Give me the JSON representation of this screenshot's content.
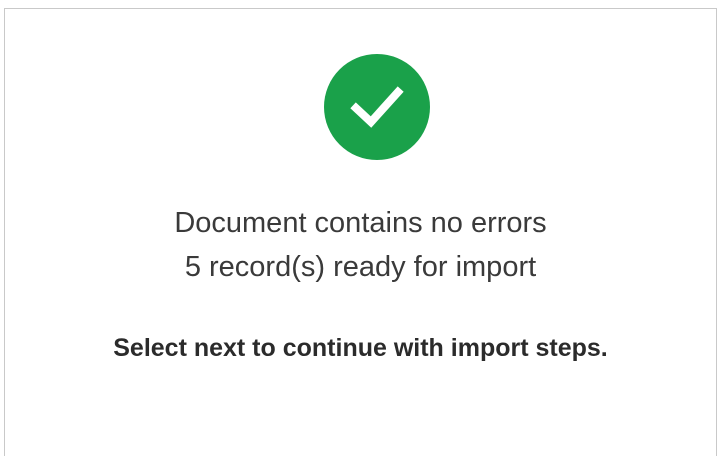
{
  "result": {
    "icon": "check-circle-icon",
    "icon_color": "#1aa14a",
    "status_message": "Document contains no errors",
    "records_message": "5 record(s) ready for import",
    "instruction": "Select next to continue with import steps."
  }
}
